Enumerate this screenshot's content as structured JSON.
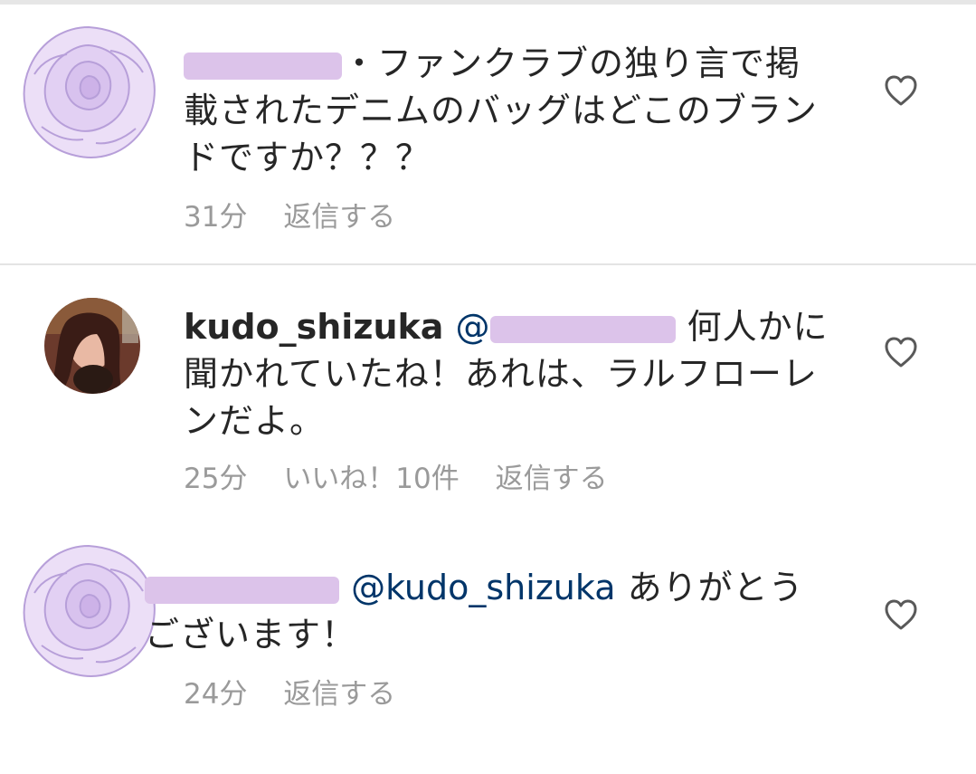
{
  "comments": [
    {
      "text": "・ファンクラブの独り言で掲載されたデニムのバッグはどこのブランドですか？？？",
      "time": "31分",
      "reply": "返信する"
    },
    {
      "username": "kudo_shizuka",
      "mention_prefix": "@",
      "text": "何人かに聞かれていたね！あれは、ラルフローレンだよ。",
      "time": "25分",
      "likes": "いいね！10件",
      "reply": "返信する"
    },
    {
      "mention": "@kudo_shizuka",
      "text": "ありがとうございます！",
      "time": "24分",
      "reply": "返信する"
    }
  ],
  "icons": {
    "avatar_rose": "rose-avatar-icon",
    "like": "heart-outline-icon"
  },
  "colors": {
    "text": "#262626",
    "meta": "#9a9a9a",
    "mention": "#003569",
    "redaction": "#dcc3ea",
    "rose": "#c9b0e6"
  }
}
